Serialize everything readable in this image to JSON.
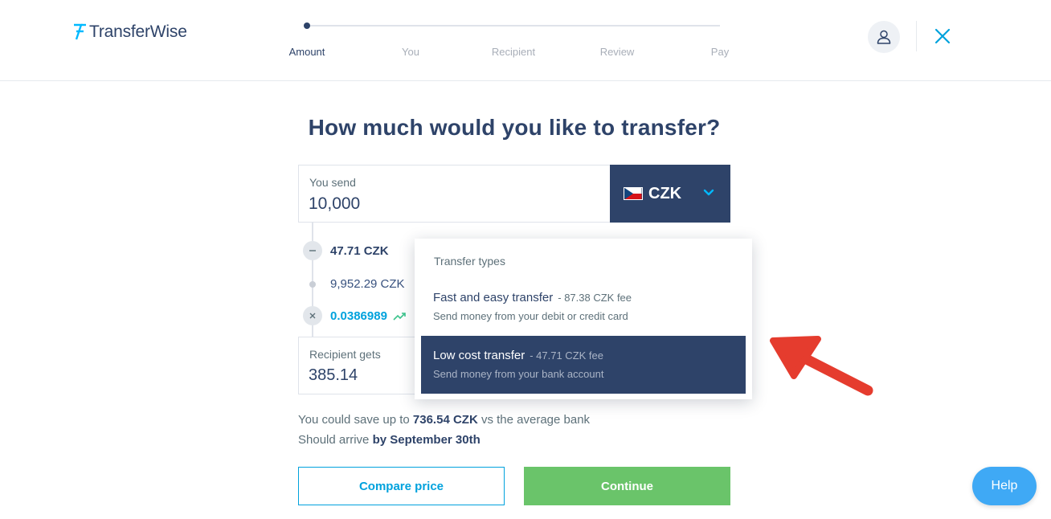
{
  "brand": {
    "name": "TransferWise"
  },
  "steps": [
    "Amount",
    "You",
    "Recipient",
    "Review",
    "Pay"
  ],
  "active_step": 0,
  "page_title": "How much would you like to transfer?",
  "send": {
    "label": "You send",
    "value": "10,000",
    "currency": "CZK"
  },
  "breakdown": {
    "fee": "47.71 CZK",
    "converted": "9,952.29 CZK",
    "rate": "0.0386989"
  },
  "receive": {
    "label": "Recipient gets",
    "value": "385.14"
  },
  "savings": {
    "line1_prefix": "You could save up to",
    "line1_amount": "736.54 CZK",
    "line1_suffix": "vs the average bank",
    "line2_prefix": "Should arrive",
    "line2_date": "by September 30th"
  },
  "buttons": {
    "compare": "Compare price",
    "continue": "Continue",
    "help": "Help"
  },
  "dropdown": {
    "header": "Transfer types",
    "options": [
      {
        "title": "Fast and easy transfer",
        "fee": "- 87.38 CZK fee",
        "desc": "Send money from your debit or credit card",
        "selected": false
      },
      {
        "title": "Low cost transfer",
        "fee": "- 47.71 CZK fee",
        "desc": "Send money from your bank account",
        "selected": true
      }
    ]
  },
  "colors": {
    "navy": "#2e4369",
    "accent_blue": "#00a2dd",
    "continue_green": "#6ac46a",
    "help_blue": "#3fa9f5",
    "annotation_red": "#e53c2e"
  },
  "icons": {
    "logo": "transferwise-flag-icon",
    "avatar": "user-icon",
    "close": "close-icon",
    "currency_flag": "czech-flag-icon",
    "chevron": "chevron-down-icon",
    "fee_op": "minus-icon",
    "rate_op": "multiply-icon",
    "rate_trend": "trending-up-icon",
    "annotation": "red-arrow-icon"
  }
}
